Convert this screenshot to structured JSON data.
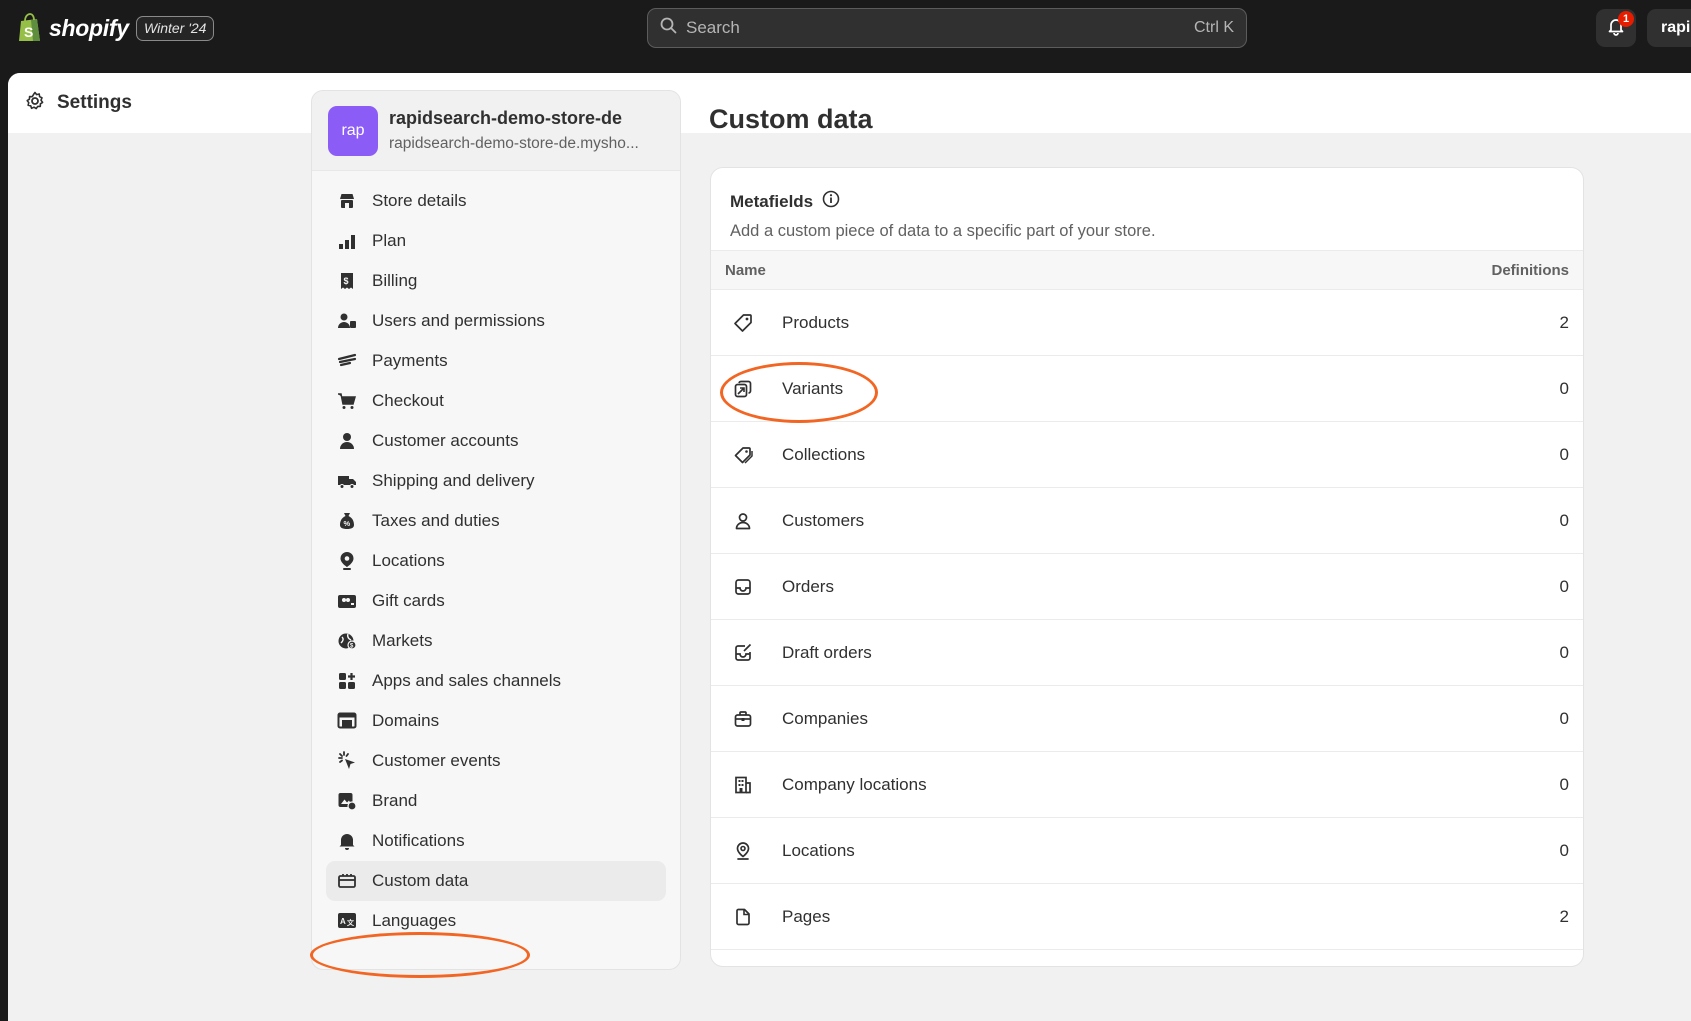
{
  "topbar": {
    "brand": "shopify",
    "version_badge": "Winter '24",
    "search_placeholder": "Search",
    "search_shortcut": "Ctrl K",
    "notification_count": "1",
    "user_label": "rapi"
  },
  "page": {
    "title": "Settings"
  },
  "store": {
    "avatar_text": "rap",
    "name": "rapidsearch-demo-store-de",
    "domain": "rapidsearch-demo-store-de.mysho..."
  },
  "sidebar": {
    "items": [
      {
        "label": "Store details",
        "icon": "store-icon"
      },
      {
        "label": "Plan",
        "icon": "plan-icon"
      },
      {
        "label": "Billing",
        "icon": "billing-icon"
      },
      {
        "label": "Users and permissions",
        "icon": "users-icon"
      },
      {
        "label": "Payments",
        "icon": "payments-icon"
      },
      {
        "label": "Checkout",
        "icon": "cart-icon"
      },
      {
        "label": "Customer accounts",
        "icon": "person-icon"
      },
      {
        "label": "Shipping and delivery",
        "icon": "truck-icon"
      },
      {
        "label": "Taxes and duties",
        "icon": "tax-icon"
      },
      {
        "label": "Locations",
        "icon": "location-pin-icon"
      },
      {
        "label": "Gift cards",
        "icon": "gift-card-icon"
      },
      {
        "label": "Markets",
        "icon": "globe-icon"
      },
      {
        "label": "Apps and sales channels",
        "icon": "apps-icon"
      },
      {
        "label": "Domains",
        "icon": "domains-icon"
      },
      {
        "label": "Customer events",
        "icon": "cursor-click-icon"
      },
      {
        "label": "Brand",
        "icon": "brand-icon"
      },
      {
        "label": "Notifications",
        "icon": "bell-icon"
      },
      {
        "label": "Custom data",
        "icon": "custom-data-icon",
        "active": true
      },
      {
        "label": "Languages",
        "icon": "language-icon"
      }
    ]
  },
  "main": {
    "title": "Custom data",
    "metafields": {
      "title": "Metafields",
      "subtitle": "Add a custom piece of data to a specific part of your store.",
      "col_name": "Name",
      "col_definitions": "Definitions",
      "rows": [
        {
          "label": "Products",
          "count": "2",
          "icon": "tag-icon"
        },
        {
          "label": "Variants",
          "count": "0",
          "icon": "variant-icon"
        },
        {
          "label": "Collections",
          "count": "0",
          "icon": "collection-icon"
        },
        {
          "label": "Customers",
          "count": "0",
          "icon": "person-icon"
        },
        {
          "label": "Orders",
          "count": "0",
          "icon": "inbox-icon"
        },
        {
          "label": "Draft orders",
          "count": "0",
          "icon": "draft-order-icon"
        },
        {
          "label": "Companies",
          "count": "0",
          "icon": "briefcase-icon"
        },
        {
          "label": "Company locations",
          "count": "0",
          "icon": "building-icon"
        },
        {
          "label": "Locations",
          "count": "0",
          "icon": "location-pin-icon"
        },
        {
          "label": "Pages",
          "count": "2",
          "icon": "page-icon"
        }
      ]
    }
  },
  "annotation_color": "#f26522"
}
